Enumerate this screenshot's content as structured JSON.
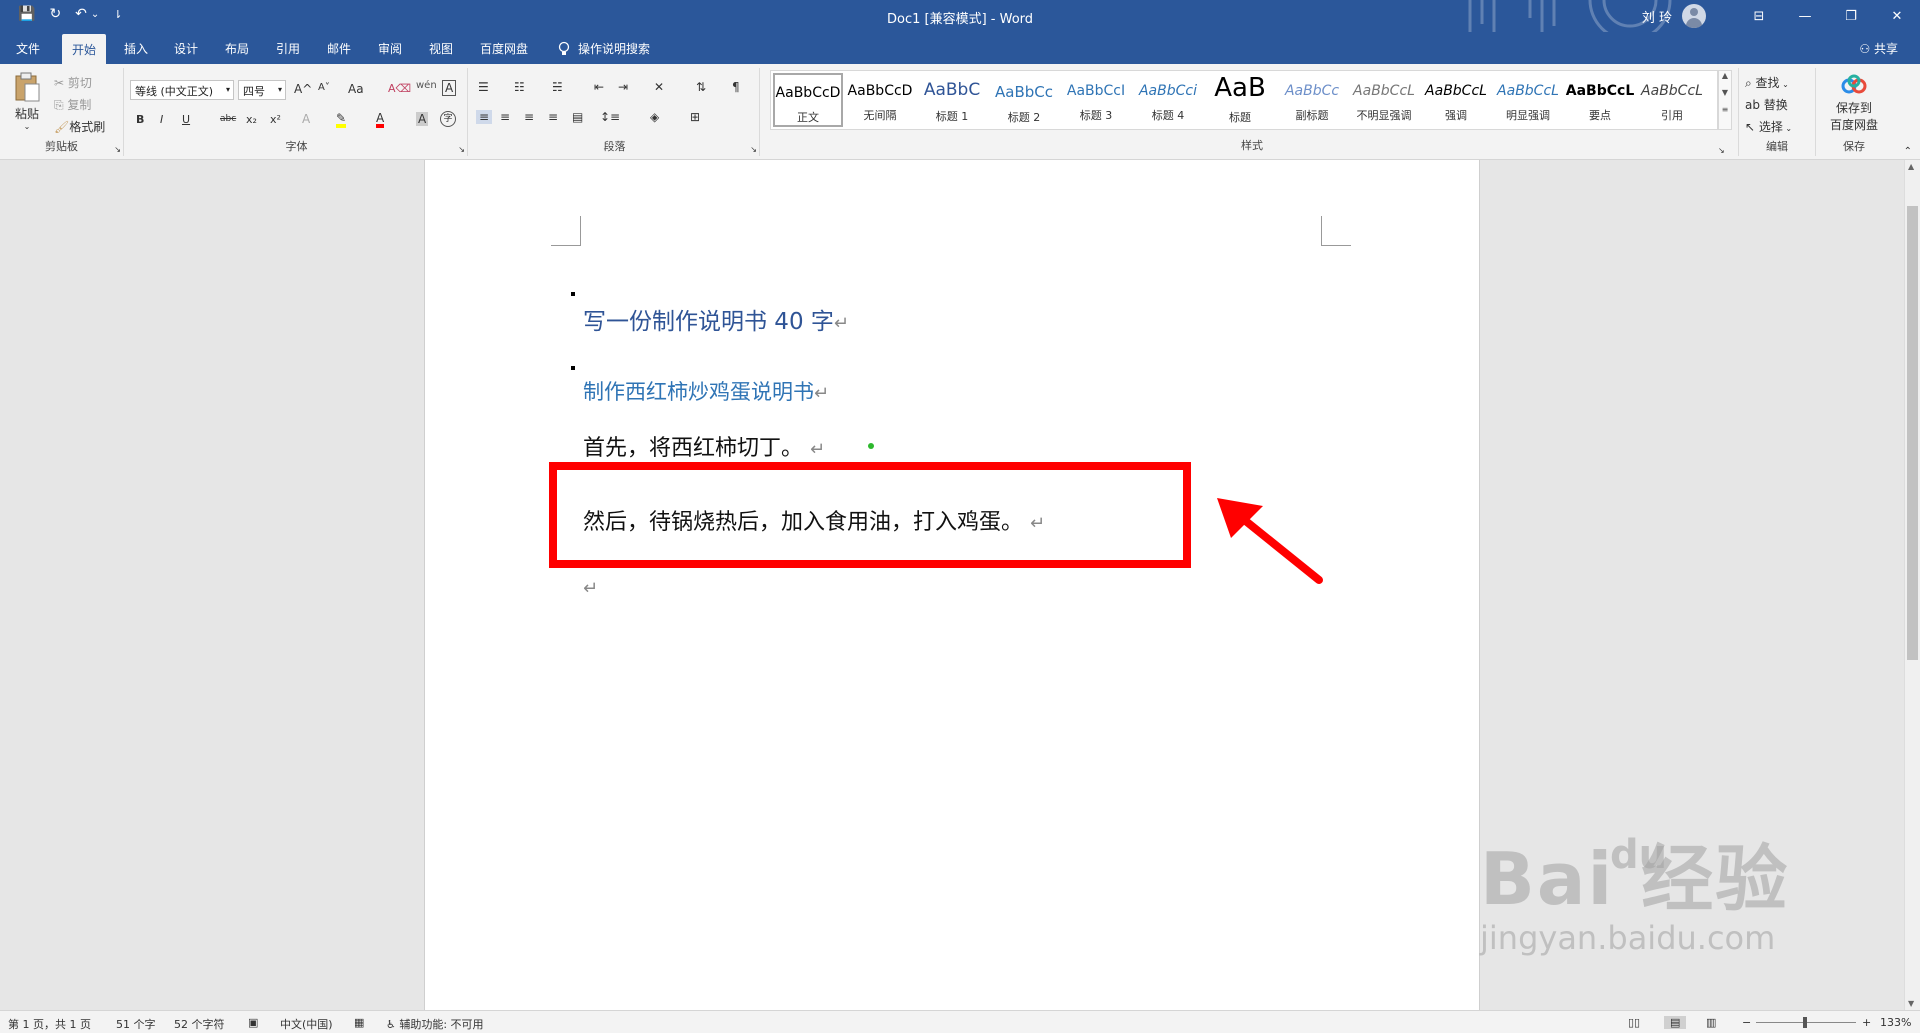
{
  "titlebar": {
    "title": "Doc1 [兼容模式] - Word",
    "user": "刘 玲",
    "qat": {
      "save": "💾",
      "redo": "↻",
      "undo": "↶",
      "undo_more": "⌄",
      "customize": "⇂"
    },
    "win": {
      "ribbon_opts": "⊟",
      "min": "—",
      "max": "❐",
      "close": "✕"
    }
  },
  "tabs": {
    "items": [
      "文件",
      "开始",
      "插入",
      "设计",
      "布局",
      "引用",
      "邮件",
      "审阅",
      "视图",
      "百度网盘"
    ],
    "active": "开始",
    "tell_me": "操作说明搜索",
    "share": "共享"
  },
  "ribbon": {
    "clipboard": {
      "label": "剪贴板",
      "paste": "粘贴",
      "cut": "剪切",
      "copy": "复制",
      "painter": "格式刷"
    },
    "font": {
      "label": "字体",
      "name": "等线 (中文正文)",
      "size": "四号",
      "bold": "B",
      "italic": "I",
      "underline": "U",
      "strike": "abc",
      "sub": "x₂",
      "sup": "x²",
      "grow": "A^",
      "shrink": "A˅",
      "case": "Aa",
      "clear": "A⌫",
      "phonetic": "wén",
      "border": "A"
    },
    "paragraph": {
      "label": "段落"
    },
    "styles": {
      "label": "样式",
      "items": [
        {
          "sample": "AaBbCcD",
          "name": "正文",
          "color": "#000000"
        },
        {
          "sample": "AaBbCcD",
          "name": "无间隔",
          "color": "#000000"
        },
        {
          "sample": "AaBbC",
          "name": "标题 1",
          "color": "#2f5496"
        },
        {
          "sample": "AaBbCc",
          "name": "标题 2",
          "color": "#2f74b5"
        },
        {
          "sample": "AaBbCcI",
          "name": "标题 3",
          "color": "#2f74b5"
        },
        {
          "sample": "AaBbCci",
          "name": "标题 4",
          "color": "#2f74b5"
        },
        {
          "sample": "AaB",
          "name": "标题",
          "color": "#000000"
        },
        {
          "sample": "AaBbCc",
          "name": "副标题",
          "color": "#6d8fc9"
        },
        {
          "sample": "AaBbCcL",
          "name": "不明显强调",
          "color": "#777777"
        },
        {
          "sample": "AaBbCcL",
          "name": "强调",
          "color": "#000000"
        },
        {
          "sample": "AaBbCcL",
          "name": "明显强调",
          "color": "#2f74b5"
        },
        {
          "sample": "AaBbCcL",
          "name": "要点",
          "color": "#000000"
        },
        {
          "sample": "AaBbCcL",
          "name": "引用",
          "color": "#444444"
        }
      ]
    },
    "editing": {
      "label": "编辑",
      "find": "查找",
      "replace": "替换",
      "select": "选择"
    },
    "save": {
      "label": "保存",
      "button_line1": "保存到",
      "button_line2": "百度网盘"
    }
  },
  "document": {
    "heading1": "写一份制作说明书 40 字",
    "heading2": "制作西红柿炒鸡蛋说明书",
    "para1": "首先，将西红柿切丁。",
    "para2": "然后，待锅烧热后，加入食用油，打入鸡蛋。",
    "para_mark": "↵",
    "highlight_color": "#ff0000"
  },
  "watermark": {
    "main": "Bai 经验",
    "du": "du",
    "sub": "jingyan.baidu.com"
  },
  "status": {
    "page": "第 1 页，共 1 页",
    "words": "51 个字",
    "chars": "52 个字符",
    "language": "中文(中国)",
    "accessibility": "辅助功能: 不可用",
    "zoom": "133%"
  }
}
